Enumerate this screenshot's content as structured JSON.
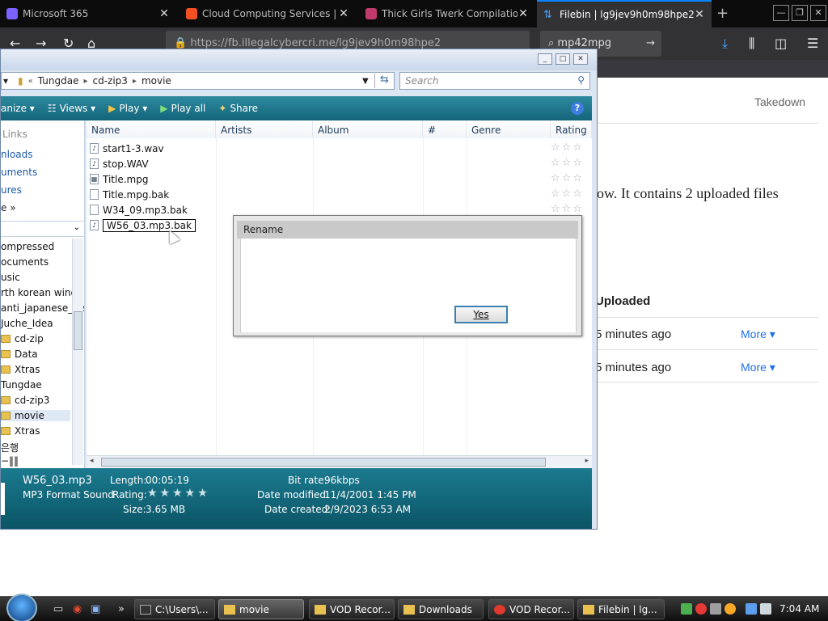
{
  "browser": {
    "tabs": [
      {
        "label": "Microsoft 365",
        "color": "#7b61ff"
      },
      {
        "label": "Cloud Computing Services | ",
        "color": "#f25022"
      },
      {
        "label": "Thick Girls Twerk Compilation",
        "color": "#c03a6b"
      },
      {
        "label": "Filebin | lg9jev9h0m98hpe2",
        "color": "#0a84ff"
      }
    ],
    "url": "https://fb.illegalcybercri.me/lg9jev9h0m98hpe2",
    "search_value": "mp42mpg"
  },
  "filebin": {
    "takedown": "Takedown",
    "contains_text": "ow. It contains 2 uploaded files",
    "uploaded_header": "Uploaded",
    "rows": [
      {
        "ago": "5 minutes ago",
        "more": "More ▾"
      },
      {
        "ago": "5 minutes ago",
        "more": "More ▾"
      }
    ]
  },
  "explorer": {
    "breadcrumb": [
      "«",
      "Tungdae",
      "▸",
      "cd-zip3",
      "▸",
      "movie"
    ],
    "search_placeholder": "Search",
    "commands": [
      "anize ▾",
      "Views ▾",
      "Play ▾",
      "Play all",
      "Share"
    ],
    "nav_links": [
      "Links",
      "nloads",
      "uments",
      "ures",
      "e  »"
    ],
    "nav_folders": [
      "ompressed",
      "ocuments",
      "usic",
      "rth korean wind",
      "anti_japanese_he",
      "Juche_Idea",
      "cd-zip",
      "Data",
      "Xtras",
      "Tungdae",
      "cd-zip3",
      "movie",
      "Xtras",
      "은행",
      "−‖‖"
    ],
    "columns": [
      "Name",
      "Artists",
      "Album",
      "#",
      "Genre",
      "Rating"
    ],
    "files": [
      {
        "name": "start1-3.wav",
        "icon": "♪"
      },
      {
        "name": "stop.WAV",
        "icon": "♪"
      },
      {
        "name": "Title.mpg",
        "icon": "▦"
      },
      {
        "name": "Title.mpg.bak",
        "icon": ""
      },
      {
        "name": "W34_09.mp3.bak",
        "icon": ""
      },
      {
        "name": "W56_03.mp3.bak",
        "icon": "♪"
      }
    ],
    "details": {
      "filename": "W56_03.mp3",
      "type": "MP3 Format Sound",
      "length_label": "Length:",
      "length": "00:05:19",
      "rating_label": "Rating:",
      "size_label": "Size:",
      "size": "3.65 MB",
      "bitrate_label": "Bit rate:",
      "bitrate": "96kbps",
      "modified_label": "Date modified:",
      "modified": "11/4/2001 1:45 PM",
      "created_label": "Date created:",
      "created": "2/9/2023 6:53 AM"
    }
  },
  "dialog": {
    "title": "Rename",
    "yes_label": "Yes"
  },
  "taskbar": {
    "buttons": [
      {
        "label": "C:\\Users\\...",
        "color": "#333"
      },
      {
        "label": "movie",
        "color": "#e9c150"
      },
      {
        "label": "VOD Recor...",
        "color": "#e9c150"
      },
      {
        "label": "Downloads",
        "color": "#e9c150"
      },
      {
        "label": "VOD Recor...",
        "color": "#e03a2e"
      },
      {
        "label": "Filebin | lg...",
        "color": "#e9c150"
      }
    ],
    "clock": "7:04 AM"
  }
}
